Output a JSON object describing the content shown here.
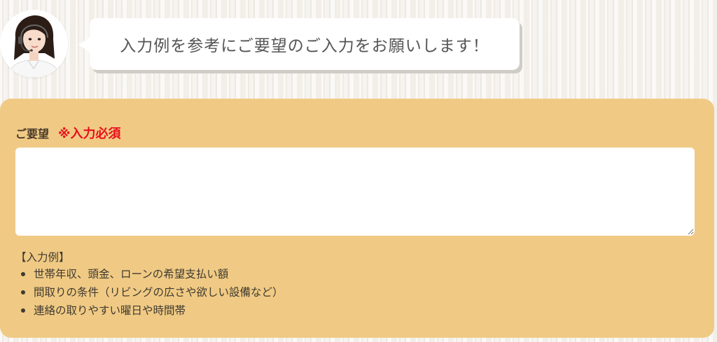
{
  "header": {
    "avatar_icon": "operator-avatar",
    "message": "入力例を参考にご要望のご入力をお願いします！"
  },
  "form": {
    "field_label": "ご要望",
    "required_text": "※入力必須",
    "textarea_value": "",
    "examples_heading": "【入力例】",
    "examples": [
      "世帯年収、頭金、ローンの希望支払い額",
      "間取りの条件（リビングの広さや欲しい設備など）",
      "連絡の取りやすい曜日や時間帯"
    ]
  },
  "colors": {
    "panel_background": "#f0ca84",
    "required": "#e8111b",
    "bubble_background": "#ffffff"
  }
}
